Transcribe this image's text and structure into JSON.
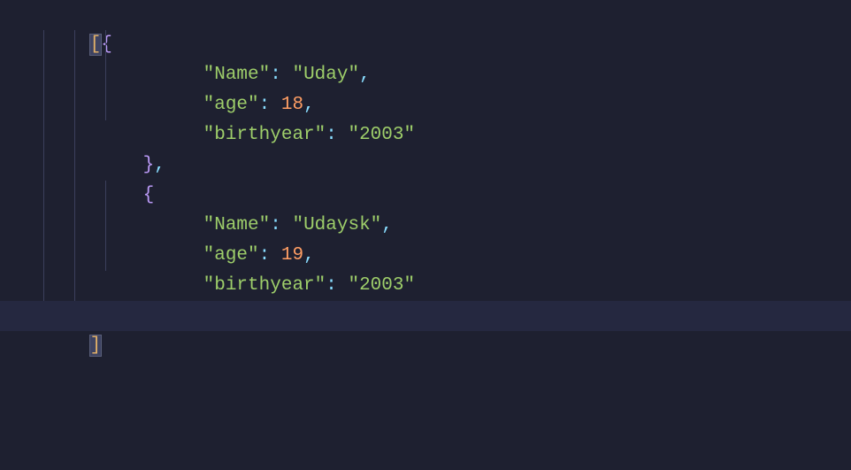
{
  "code": {
    "brackets": {
      "open_array": "[",
      "close_array": "]",
      "open_obj": "{",
      "close_obj": "}"
    },
    "punctuation": {
      "comma": ",",
      "colon": ":",
      "quote": "\""
    },
    "obj1": {
      "key1": "\"Name\"",
      "val1": "\"Uday\"",
      "key2": "\"age\"",
      "val2": "18",
      "key3": "\"birthyear\"",
      "val3": "\"2003\""
    },
    "obj2": {
      "key1": "\"Name\"",
      "val1": "\"Udaysk\"",
      "key2": "\"age\"",
      "val2": "19",
      "key3": "\"birthyear\"",
      "val3": "\"2003\""
    }
  }
}
